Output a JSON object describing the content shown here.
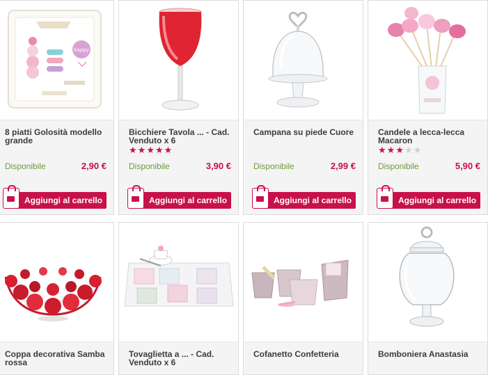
{
  "colors": {
    "accent": "#c8104a",
    "available": "#6c9a3b",
    "text": "#3c3c3c"
  },
  "products": [
    {
      "title": "8 piatti Golosità modello grande",
      "rating": 0,
      "availability": "Disponibile",
      "price": "2,90 €",
      "button": "Aggiungi al carrello",
      "image": "square-plate-with-macarons"
    },
    {
      "title": "Bicchiere Tavola ... - Cad. Venduto x 6",
      "rating": 5,
      "availability": "Disponibile",
      "price": "3,90 €",
      "button": "Aggiungi al carrello",
      "image": "red-wine-glass"
    },
    {
      "title": "Campana su piede Cuore",
      "rating": 0,
      "availability": "Disponibile",
      "price": "2,99 €",
      "button": "Aggiungi al carrello",
      "image": "glass-dome-on-stand"
    },
    {
      "title": "Candele a lecca-lecca Macaron",
      "rating": 3,
      "availability": "Disponibile",
      "price": "5,90 €",
      "button": "Aggiungi al carrello",
      "image": "macaron-lollipop-candles"
    },
    {
      "title": "Coppa decorativa Samba rossa",
      "image": "red-decorative-bowl"
    },
    {
      "title": "Tovaglietta a ... - Cad. Venduto x 6",
      "image": "placemat-with-cups"
    },
    {
      "title": "Cofanetto Confetteria",
      "image": "pastry-set-cups"
    },
    {
      "title": "Bomboniera Anastasia",
      "image": "glass-apothecary-jar"
    }
  ]
}
